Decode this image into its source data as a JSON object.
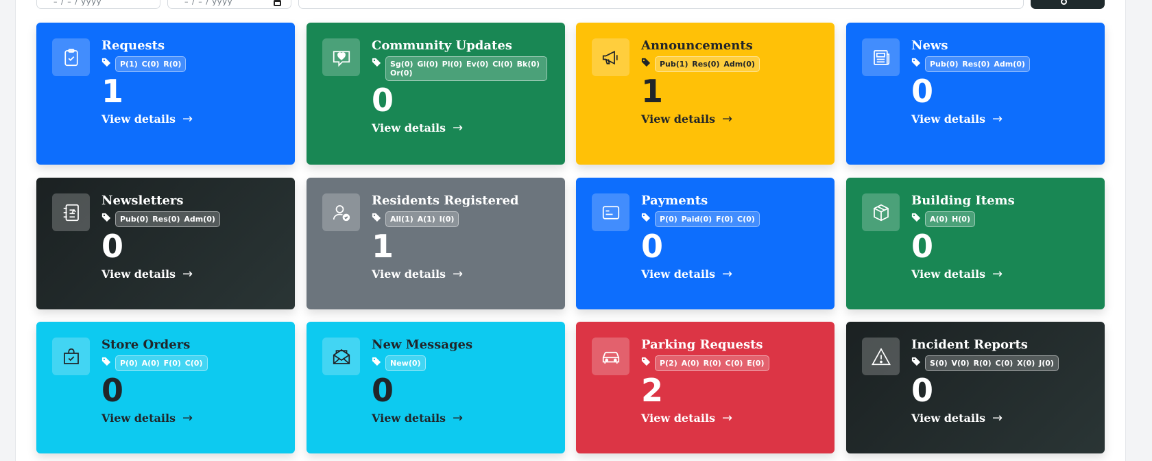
{
  "filters": {
    "date_from_placeholder": "– / – / yyyy",
    "date_to_placeholder": "– / – / yyyy"
  },
  "cards": [
    {
      "title": "Requests",
      "icon": "clipboard-check-icon",
      "tags": "P(1) C(0) R(0)",
      "count": "1",
      "link": "View details",
      "color": "#0d6efd"
    },
    {
      "title": "Community Updates",
      "icon": "chat-heart-icon",
      "tags": "Sg(0) Gl(0) Pl(0) Ev(0) Cl(0) Bk(0) Or(0)",
      "count": "0",
      "link": "View details",
      "color": "#198754"
    },
    {
      "title": "Announcements",
      "icon": "megaphone-icon",
      "tags": "Pub(1) Res(0) Adm(0)",
      "count": "1",
      "link": "View details",
      "color": "#ffc107"
    },
    {
      "title": "News",
      "icon": "newspaper-icon",
      "tags": "Pub(0) Res(0) Adm(0)",
      "count": "0",
      "link": "View details",
      "color": "#0d6efd"
    },
    {
      "title": "Newsletters",
      "icon": "journal-text-icon",
      "tags": "Pub(0) Res(0) Adm(0)",
      "count": "0",
      "link": "View details",
      "color": "#212529"
    },
    {
      "title": "Residents Registered",
      "icon": "person-check-icon",
      "tags": "All(1) A(1) I(0)",
      "count": "1",
      "link": "View details",
      "color": "#6c757d"
    },
    {
      "title": "Payments",
      "icon": "credit-card-icon",
      "tags": "P(0) Paid(0) F(0) C(0)",
      "count": "0",
      "link": "View details",
      "color": "#0d6efd"
    },
    {
      "title": "Building Items",
      "icon": "box-icon",
      "tags": "A(0) H(0)",
      "count": "0",
      "link": "View details",
      "color": "#198754"
    },
    {
      "title": "Store Orders",
      "icon": "shopping-bag-icon",
      "tags": "P(0) A(0) F(0) C(0)",
      "count": "0",
      "link": "View details",
      "color": "#0dcaf0"
    },
    {
      "title": "New Messages",
      "icon": "envelope-open-icon",
      "tags": "New(0)",
      "count": "0",
      "link": "View details",
      "color": "#0dcaf0"
    },
    {
      "title": "Parking Requests",
      "icon": "car-icon",
      "tags": "P(2) A(0) R(0) C(0) E(0)",
      "count": "2",
      "link": "View details",
      "color": "#dc3545"
    },
    {
      "title": "Incident Reports",
      "icon": "warning-triangle-icon",
      "tags": "S(0) V(0) R(0) C(0) X(0) J(0)",
      "count": "0",
      "link": "View details",
      "color": "#212529"
    }
  ]
}
